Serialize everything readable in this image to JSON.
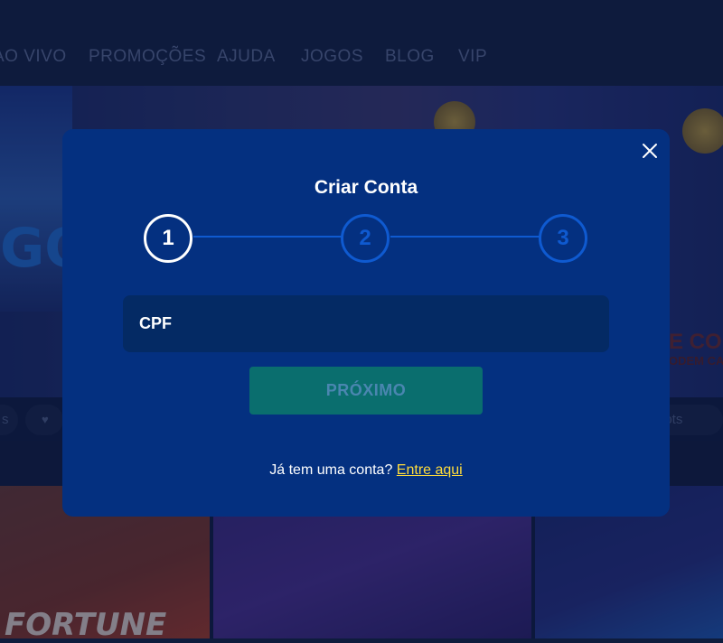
{
  "nav": {
    "items": [
      {
        "label": "AO VIVO"
      },
      {
        "label": "PROMOÇÕES"
      },
      {
        "label": "AJUDA"
      },
      {
        "label": "JOGOS"
      },
      {
        "label": "BLOG"
      },
      {
        "label": "VIP"
      }
    ]
  },
  "background": {
    "hero_left_text": "GO",
    "hero_right_text": "E COM",
    "hero_right_sub": "ODEM CAUS",
    "chips": [
      {
        "label": "s"
      },
      {
        "label": ""
      },
      {
        "label": "lots"
      }
    ],
    "card1_title": "FORTUNE"
  },
  "modal": {
    "title": "Criar Conta",
    "steps": [
      {
        "number": "1",
        "state": "active"
      },
      {
        "number": "2",
        "state": "pending"
      },
      {
        "number": "3",
        "state": "pending"
      }
    ],
    "cpf_placeholder": "CPF",
    "next_label": "PRÓXIMO",
    "login_prompt": "Já tem uma conta?",
    "login_link": "Entre aqui"
  },
  "colors": {
    "modal_bg": "#043080",
    "input_bg": "#042a64",
    "button_bg": "#0a6e6e",
    "link": "#ffdc3b",
    "step_idle": "#0f5ad0"
  }
}
